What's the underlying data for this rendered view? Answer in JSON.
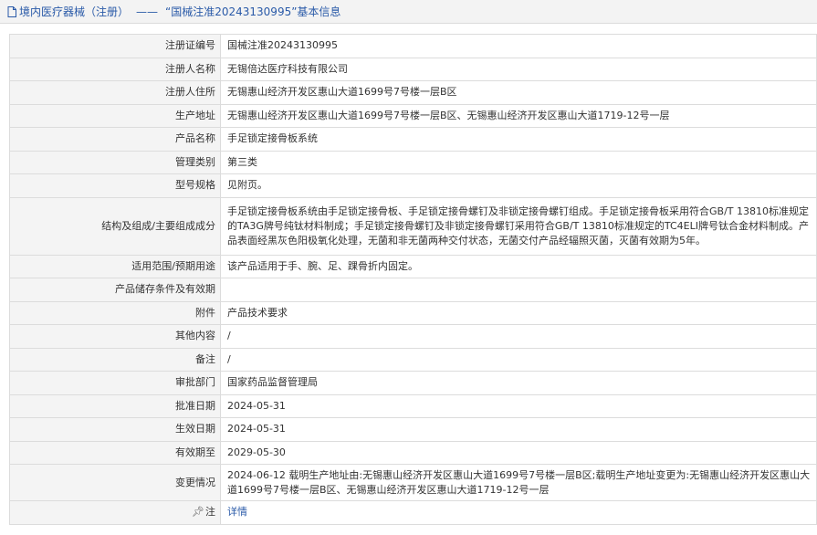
{
  "header": {
    "section": "境内医疗器械（注册）",
    "separator": "——",
    "title": "“国械注准20243130995”基本信息"
  },
  "rows": [
    {
      "label": "注册证编号",
      "value": "国械注准20243130995"
    },
    {
      "label": "注册人名称",
      "value": "无锡倍达医疗科技有限公司"
    },
    {
      "label": "注册人住所",
      "value": "无锡惠山经济开发区惠山大道1699号7号楼一层B区"
    },
    {
      "label": "生产地址",
      "value": "无锡惠山经济开发区惠山大道1699号7号楼一层B区、无锡惠山经济开发区惠山大道1719-12号一层"
    },
    {
      "label": "产品名称",
      "value": "手足锁定接骨板系统"
    },
    {
      "label": "管理类别",
      "value": "第三类"
    },
    {
      "label": "型号规格",
      "value": "见附页。"
    },
    {
      "label": "结构及组成/主要组成成分",
      "value": "手足锁定接骨板系统由手足锁定接骨板、手足锁定接骨螺钉及非锁定接骨螺钉组成。手足锁定接骨板采用符合GB/T 13810标准规定的TA3G牌号纯钛材料制成；手足锁定接骨螺钉及非锁定接骨螺钉采用符合GB/T 13810标准规定的TC4ELI牌号钛合金材料制成。产品表面经黑灰色阳极氧化处理，无菌和非无菌两种交付状态，无菌交付产品经辐照灭菌，灭菌有效期为5年。"
    },
    {
      "label": "适用范围/预期用途",
      "value": "该产品适用于手、腕、足、踝骨折内固定。"
    },
    {
      "label": "产品储存条件及有效期",
      "value": ""
    },
    {
      "label": "附件",
      "value": "产品技术要求"
    },
    {
      "label": "其他内容",
      "value": "/"
    },
    {
      "label": "备注",
      "value": "/"
    },
    {
      "label": "审批部门",
      "value": "国家药品监督管理局"
    },
    {
      "label": "批准日期",
      "value": "2024-05-31"
    },
    {
      "label": "生效日期",
      "value": "2024-05-31"
    },
    {
      "label": "有效期至",
      "value": "2029-05-30"
    },
    {
      "label": "变更情况",
      "value": "2024-06-12 载明生产地址由:无锡惠山经济开发区惠山大道1699号7号楼一层B区;载明生产地址变更为:无锡惠山经济开发区惠山大道1699号7号楼一层B区、无锡惠山经济开发区惠山大道1719-12号一层"
    }
  ],
  "note": {
    "label": "注",
    "link": "详情"
  }
}
